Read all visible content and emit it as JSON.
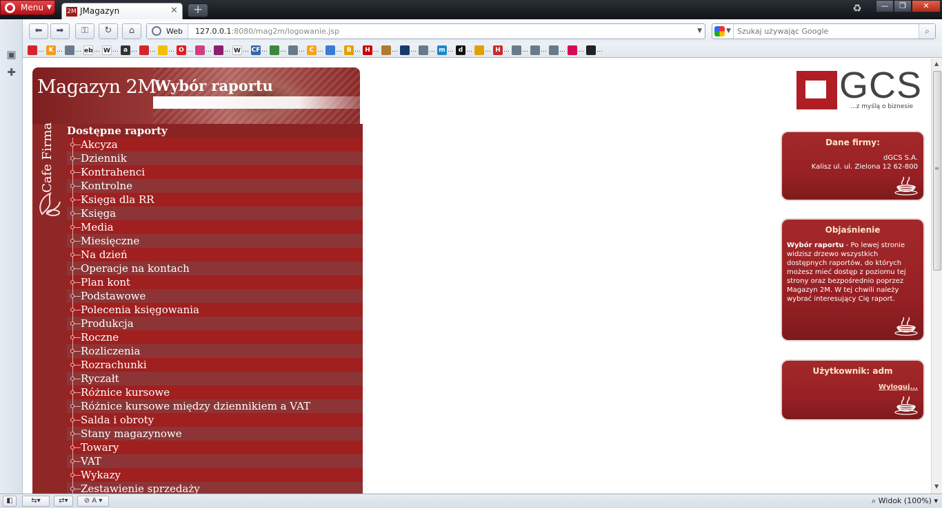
{
  "browser": {
    "menu_label": "Menu",
    "tab_title": "JMagazyn",
    "tab_favicon_text": "2M",
    "address": {
      "mode_label": "Web",
      "url_host": "127.0.0.1",
      "url_rest": ":8080/mag2m/logowanie.jsp"
    },
    "search_placeholder": "Szukaj używając Google",
    "zoom_label": "Widok (100%)"
  },
  "bookmarks": [
    {
      "icon": "opera-heart-icon",
      "color": "#d9232c",
      "text": ""
    },
    {
      "icon": "k-icon",
      "color": "#f29b1d",
      "text": "K"
    },
    {
      "icon": "star-icon",
      "color": "#6a7a8c",
      "text": ""
    },
    {
      "icon": "ebay-icon",
      "color": "#ffffff",
      "text": "eb"
    },
    {
      "icon": "wikipedia-icon",
      "color": "#ffffff",
      "text": "W"
    },
    {
      "icon": "amazon-icon",
      "color": "#333333",
      "text": "a"
    },
    {
      "icon": "opera-heart-icon",
      "color": "#d9232c",
      "text": ""
    },
    {
      "icon": "game-icon",
      "color": "#f0c000",
      "text": ""
    },
    {
      "icon": "opera-o-icon",
      "color": "#e21b23",
      "text": "O"
    },
    {
      "icon": "notepad-icon",
      "color": "#d04080",
      "text": ""
    },
    {
      "icon": "cart-icon",
      "color": "#8b1e6e",
      "text": ""
    },
    {
      "icon": "wikipedia-icon",
      "color": "#ffffff",
      "text": "W"
    },
    {
      "icon": "cf-icon",
      "color": "#3366aa",
      "text": "CF"
    },
    {
      "icon": "money-icon",
      "color": "#3a8a3a",
      "text": ""
    },
    {
      "icon": "star-icon",
      "color": "#6a7a8c",
      "text": ""
    },
    {
      "icon": "ceneo-icon",
      "color": "#f7a21a",
      "text": "C"
    },
    {
      "icon": "rss-globe-icon",
      "color": "#3a7bd5",
      "text": ""
    },
    {
      "icon": "bestsoft-icon",
      "color": "#e0a000",
      "text": "B"
    },
    {
      "icon": "h-icon",
      "color": "#cc0000",
      "text": "H"
    },
    {
      "icon": "squirrel-icon",
      "color": "#b07a30",
      "text": ""
    },
    {
      "icon": "nav-icon",
      "color": "#1a3a6a",
      "text": ""
    },
    {
      "icon": "star-icon",
      "color": "#6a7a8c",
      "text": ""
    },
    {
      "icon": "m-icon",
      "color": "#1e88c7",
      "text": "m"
    },
    {
      "icon": "d-icon",
      "color": "#111111",
      "text": "d"
    },
    {
      "icon": "shield-icon",
      "color": "#e0a000",
      "text": ""
    },
    {
      "icon": "hifi-icon",
      "color": "#c72c2c",
      "text": "H"
    },
    {
      "icon": "star-icon",
      "color": "#6a7a8c",
      "text": ""
    },
    {
      "icon": "star-icon",
      "color": "#6a7a8c",
      "text": ""
    },
    {
      "icon": "star-icon",
      "color": "#6a7a8c",
      "text": ""
    },
    {
      "icon": "debian-icon",
      "color": "#d70a53",
      "text": ""
    },
    {
      "icon": "dots-icon",
      "color": "#222222",
      "text": ""
    }
  ],
  "page": {
    "app_title": "Magazyn 2M",
    "section_title": "Wybór raportu",
    "sidebar_vertical_text": "Cafe Firma",
    "tree_title": "Dostępne raporty",
    "reports": [
      "Akcyza",
      "Dziennik",
      "Kontrahenci",
      "Kontrolne",
      "Księga dla RR",
      "Księga",
      "Media",
      "Miesięczne",
      "Na dzień",
      "Operacje na kontach",
      "Plan kont",
      "Podstawowe",
      "Polecenia księgowania",
      "Produkcja",
      "Roczne",
      "Rozliczenia",
      "Rozrachunki",
      "Ryczałt",
      "Różnice kursowe",
      "Różnice kursowe między dziennikiem a VAT",
      "Salda i obroty",
      "Stany magazynowe",
      "Towary",
      "VAT",
      "Wykazy",
      "Zestawienie sprzedaży"
    ],
    "logo": {
      "text": "GCS",
      "tagline": "...z myślą o biznesie",
      "color": "#b01d25"
    },
    "company_box": {
      "title": "Dane firmy:",
      "name": "dGCS S.A.",
      "address": "Kalisz ul. ul. Zielona 12 62-800"
    },
    "help_box": {
      "title": "Objaśnienie",
      "bold_lead": "Wybór raportu",
      "text": " - Po lewej stronie widzisz drzewo wszystkich dostępnych raportów, do których możesz mieć dostęp z poziomu tej strony oraz bezpośrednio poprzez Magazyn 2M. W tej chwili należy wybrać interesujący Cię raport."
    },
    "user_box": {
      "title": "Użytkownik: adm",
      "logout_label": "Wyloguj..."
    }
  }
}
